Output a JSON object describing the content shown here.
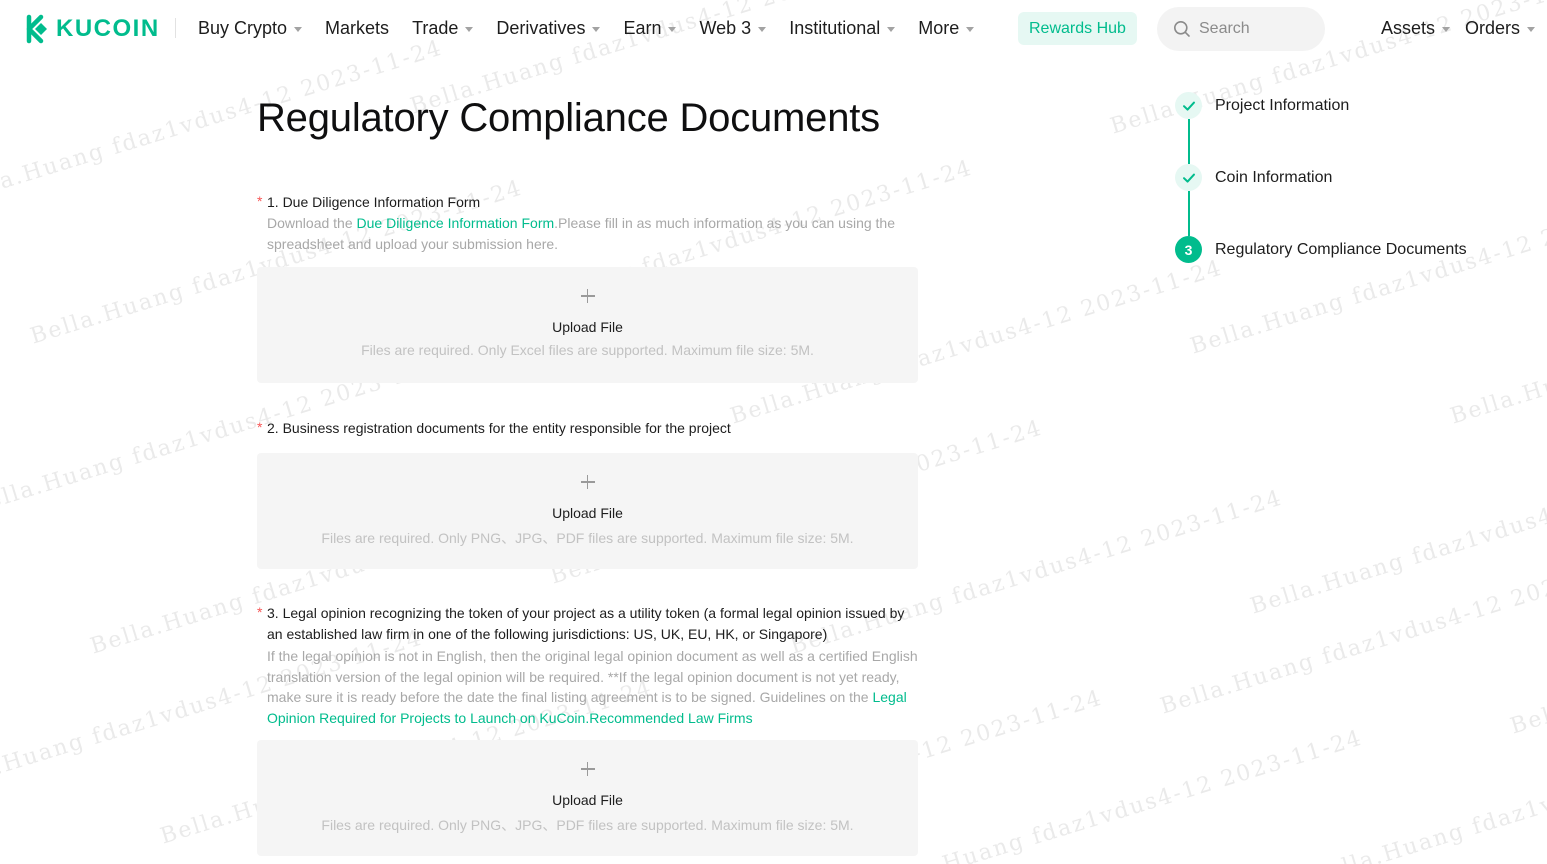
{
  "brand": {
    "name": "KUCOIN",
    "color": "#01bc8d"
  },
  "nav": {
    "items": [
      {
        "label": "Buy Crypto",
        "dropdown": true
      },
      {
        "label": "Markets",
        "dropdown": false
      },
      {
        "label": "Trade",
        "dropdown": true
      },
      {
        "label": "Derivatives",
        "dropdown": true
      },
      {
        "label": "Earn",
        "dropdown": true
      },
      {
        "label": "Web 3",
        "dropdown": true
      },
      {
        "label": "Institutional",
        "dropdown": true
      },
      {
        "label": "More",
        "dropdown": true
      }
    ],
    "rewards_label": "Rewards Hub",
    "search_placeholder": "Search",
    "assets_label": "Assets",
    "orders_label": "Orders"
  },
  "page": {
    "title": "Regulatory Compliance Documents"
  },
  "sections": [
    {
      "required_mark": "*",
      "title": "1. Due Diligence Information Form",
      "desc_prefix": "Download the ",
      "desc_link": "Due Diligence Information Form",
      "desc_suffix": ".Please fill in as much information as you can using the spreadsheet and upload your submission here.",
      "upload_label": "Upload File",
      "upload_hint": "Files are required. Only Excel files are supported. Maximum file size: 5M."
    },
    {
      "required_mark": "*",
      "title": "2. Business registration documents for the entity responsible for the project",
      "upload_label": "Upload File",
      "upload_hint": "Files are required. Only PNG、JPG、PDF files are supported. Maximum file size: 5M."
    },
    {
      "required_mark": "*",
      "title": "3. Legal opinion recognizing the token of your project as a utility token (a formal legal opinion issued by an established law firm in one of the following jurisdictions: US, UK, EU, HK, or Singapore)",
      "desc_prefix": "If the legal opinion is not in English, then the original legal opinion document as well as a certified English translation version of the legal opinion will be required. **If the legal opinion document is not yet ready, make sure it is ready before the date the final listing agreement is to be signed. Guidelines on the ",
      "desc_link": "Legal Opinion Required for Projects to Launch on KuCoin",
      "desc_link2": "Recommended Law Firms",
      "upload_label": "Upload File",
      "upload_hint": "Files are required. Only PNG、JPG、PDF files are supported. Maximum file size: 5M."
    }
  ],
  "steps": [
    {
      "label": "Project Information",
      "status": "done",
      "icon": "check-icon"
    },
    {
      "label": "Coin Information",
      "status": "done",
      "icon": "check-icon"
    },
    {
      "label": "Regulatory Compliance Documents",
      "status": "active",
      "number": "3"
    }
  ],
  "watermark": {
    "name": "Bella.Huang",
    "id": "fdaz1vdus4-12",
    "date": "2023-11-24"
  }
}
